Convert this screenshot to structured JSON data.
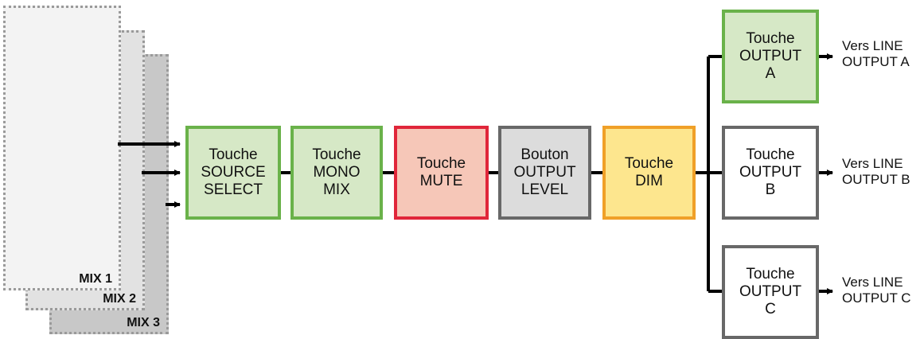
{
  "mix_panels": [
    "MIX 1",
    "MIX 2",
    "MIX 3"
  ],
  "chain": [
    {
      "id": "source-select",
      "label": "Touche\nSOURCE\nSELECT"
    },
    {
      "id": "mono-mix",
      "label": "Touche\nMONO\nMIX"
    },
    {
      "id": "mute",
      "label": "Touche\nMUTE"
    },
    {
      "id": "output-level",
      "label": "Bouton\nOUTPUT\nLEVEL"
    },
    {
      "id": "dim",
      "label": "Touche\nDIM"
    }
  ],
  "outputs": [
    {
      "id": "output-a",
      "label": "Touche\nOUTPUT\nA",
      "destination": "Vers LINE\nOUTPUT A"
    },
    {
      "id": "output-b",
      "label": "Touche\nOUTPUT\nB",
      "destination": "Vers LINE\nOUTPUT B"
    },
    {
      "id": "output-c",
      "label": "Touche\nOUTPUT\nC",
      "destination": "Vers LINE\nOUTPUT C"
    }
  ],
  "colors": {
    "green_fill": "#d6e8c6",
    "green_border": "#6ab24a",
    "red_fill": "#f6c7b8",
    "red_border": "#e0263a",
    "gray_fill": "#dcdcdc",
    "gray_border": "#686868",
    "orange_fill": "#fde68e",
    "orange_border": "#f0a028"
  }
}
